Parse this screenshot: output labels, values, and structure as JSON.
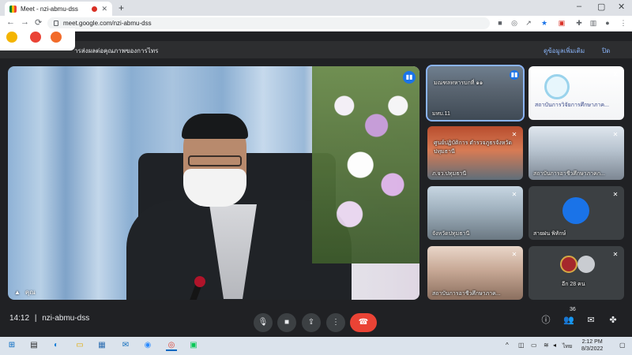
{
  "browser": {
    "tab_title": "Meet - nzi-abmu-dss",
    "url": "meet.google.com/nzi-abmu-dss",
    "new_tab": "+",
    "window_controls": [
      "–",
      "▢",
      "✕"
    ],
    "nav": [
      "←",
      "→",
      "⟳"
    ],
    "toolbar_icons": [
      "camera-icon",
      "lens-icon",
      "share-icon",
      "bookmark-star-icon",
      "extension-icon",
      "puzzle-icon",
      "sidepanel-icon",
      "profile-icon",
      "menu-icon"
    ]
  },
  "banner": {
    "text": "ารส่งผลต่อคุณภาพของการไทร",
    "more_label": "ดูข้อมูลเพิ่มเติม",
    "close_label": "ปิด"
  },
  "main_speaker": {
    "name": "คุณ"
  },
  "tiles": [
    {
      "name": "มทบ.11",
      "overlay": "มณฑลทหารบกที่ ๑๑",
      "speaking": true
    },
    {
      "name": "",
      "overlay": "สถาบันการวิจัยการศึกษาภาค...",
      "speaking": false
    },
    {
      "name": "ภ.จว.ปทุมธานี",
      "overlay": "ศูนย์ปฏิบัติการ ตำรวจภูธรจังหวัดปทุมธานี",
      "speaking": false
    },
    {
      "name": "สถาบันการอาชีวศึกษาภาคก...",
      "overlay": "",
      "speaking": false
    },
    {
      "name": "จังหวัดปทุมธานี",
      "overlay": "",
      "speaking": false
    },
    {
      "name": "สายฝน พิทักษ์",
      "overlay": "",
      "speaking": false
    },
    {
      "name": "สถาบันการอาชีวศึกษาภาค...",
      "overlay": "",
      "speaking": false
    },
    {
      "name": "อีก 28 คน",
      "overlay": "",
      "speaking": false
    }
  ],
  "bottom_bar": {
    "time": "14:12",
    "separator": "|",
    "meeting_code": "nzi-abmu-dss",
    "participant_count": "36",
    "controls": [
      "mic-icon",
      "camera-icon",
      "present-icon",
      "more-icon",
      "end-call-icon"
    ]
  },
  "taskbar": {
    "lang": "ไทย",
    "time": "2:12 PM",
    "date": "8/3/2022",
    "apps": [
      "windows-start-icon",
      "task-view-icon",
      "edge-icon",
      "file-explorer-icon",
      "store-icon",
      "mail-icon",
      "zoom-icon",
      "chrome-icon",
      "line-icon"
    ]
  },
  "colors": {
    "meet_bg": "#202124",
    "end_call": "#ea4335",
    "accent": "#1a73e8"
  }
}
